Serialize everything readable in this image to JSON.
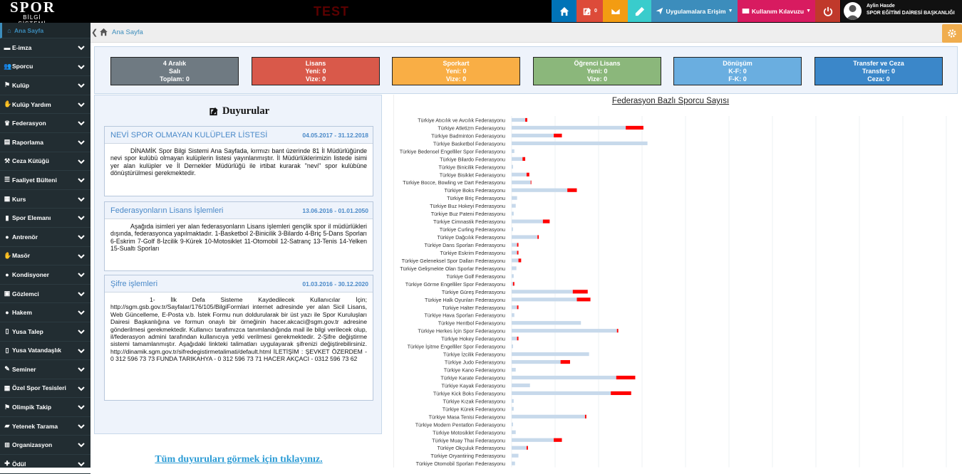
{
  "brand": {
    "logo_big": "SPOR",
    "logo_small": "BİLGİ SİSTEMİ",
    "env_label": "TEST"
  },
  "topbar": {
    "notification_count": "0",
    "app_access_label": "Uygulamalara Erişim",
    "guide_label": "Kullanım Kılavuzu",
    "user_name": "Aylin Hasde",
    "user_dept": "SPOR EĞİTİMİ DAİRESİ BAŞKANLIĞI",
    "colors": {
      "home": "#0073b7",
      "notify": "#dd4b39",
      "mail": "#f39c12",
      "edit": "#39cccc",
      "apps": "#3c8dbc",
      "guide": "#d81b60",
      "power": "#c0392b"
    }
  },
  "sidebar": {
    "items": [
      {
        "label": "Ana Sayfa",
        "icon": "home-icon"
      },
      {
        "label": "E-imza",
        "icon": "card-icon"
      },
      {
        "label": "Sporcu",
        "icon": "users-icon"
      },
      {
        "label": "Kulüp",
        "icon": "flag-icon"
      },
      {
        "label": "Kulüp Yardım",
        "icon": "handshake-icon"
      },
      {
        "label": "Federasyon",
        "icon": "trophy-icon"
      },
      {
        "label": "Raporlama",
        "icon": "report-icon"
      },
      {
        "label": "Ceza Kütüğü",
        "icon": "gavel-icon"
      },
      {
        "label": "Faaliyet Bülteni",
        "icon": "list-icon"
      },
      {
        "label": "Kurs",
        "icon": "building-icon"
      },
      {
        "label": "Spor Elemanı",
        "icon": "book-icon"
      },
      {
        "label": "Antrenör",
        "icon": "user-icon"
      },
      {
        "label": "Masör",
        "icon": "hand-icon"
      },
      {
        "label": "Kondisyoner",
        "icon": "user-icon"
      },
      {
        "label": "Gözlemci",
        "icon": "id-icon"
      },
      {
        "label": "Hakem",
        "icon": "user-icon"
      },
      {
        "label": "Yusa Talep",
        "icon": "doc-icon"
      },
      {
        "label": "Yusa Vatandaşlık",
        "icon": "doc-icon"
      },
      {
        "label": "Seminer",
        "icon": "edit-icon"
      },
      {
        "label": "Özel Spor Tesisleri",
        "icon": "building-icon"
      },
      {
        "label": "Olimpik Takip",
        "icon": "flag-icon"
      },
      {
        "label": "Yetenek Tarama",
        "icon": "car-icon"
      },
      {
        "label": "Organizasyon",
        "icon": "sitemap-icon"
      },
      {
        "label": "Ödül",
        "icon": "gift-icon"
      }
    ]
  },
  "breadcrumb": {
    "home": "Ana Sayfa"
  },
  "stats": [
    {
      "title": "4 Aralık",
      "line1": "Salı",
      "line2": "Toplam: 0",
      "color": "#6f7a82"
    },
    {
      "title": "Lisans",
      "line1": "Yeni: 0",
      "line2": "Vize: 0",
      "color": "#d9594a"
    },
    {
      "title": "Sporkart",
      "line1": "Yeni: 0",
      "line2": "Vize: 0",
      "color": "#f9ae45"
    },
    {
      "title": "Öğrenci Lisans",
      "line1": "Yeni: 0",
      "line2": "Vize: 0",
      "color": "#8bb77b"
    },
    {
      "title": "Dönüşüm",
      "line1": "K-F: 0",
      "line2": "F-K: 0",
      "color": "#6aaee0"
    },
    {
      "title": "Transfer ve Ceza",
      "line1": "Transfer: 0",
      "line2": "Ceza: 0",
      "color": "#3b87c9"
    }
  ],
  "announcements": {
    "title": "Duyurular",
    "link": "Tüm duyuruları görmek için tıklayınız.",
    "items": [
      {
        "title": "NEVİ SPOR OLMAYAN KULÜPLER LİSTESİ",
        "date": "04.05.2017 - 31.12.2018",
        "body": "DİNAMİK Spor Bilgi Sistemi Ana Sayfada, kırmızı bant üzerinde 81 İl Müdürlüğünde nevi spor kulübü olmayan kulüplerin listesi yayınlanmıştır. İl Müdürlüklerimizin listede isimi yer alan kulüpler ve İl Dernekler Müdürlüğü ile irtibat kurarak \"nevi\" spor kulübüne dönüştürülmesi gerekmektedir."
      },
      {
        "title": "Federasyonların Lisans İşlemleri",
        "date": "13.06.2016 - 01.01.2050",
        "body": "Aşağıda isimleri yer alan federasyonların Lisans işlemleri gençlik spor il müdürlükleri dışında, federasyonca yapılmaktadır. 1-Basketbol 2-Binicilik 3-Bilardo 4-Briç 5-Dans Sporları 6-Eskrim 7-Golf 8-İzcilik 9-Kürek 10-Motosiklet 11-Otomobil 12-Satranç 13-Tenis 14-Yelken 15-Sualtı Sporları"
      },
      {
        "title": "Şifre işlemleri",
        "date": "01.03.2016 - 30.12.2020",
        "body": "1- İlk Defa Sisteme Kaydedilecek Kullanıcılar İçin; http://sgm.gsb.gov.tr/Sayfalar/176/105/BilgiFormlari internet adresinde yer alan Sicil Lisans, Web Güncelleme, E-Posta v.b. İstek Formu nun doldurularak bir üst yazı ile Spor Kuruluşları Dairesi Başkanlığına ve formun onaylı bir örneğinin hacer.akcaci@sgm.gov.tr adresine gönderilmesi gerekmektedir. Kullanıcı tarafımızca tanımlandığında mail ile bilgi verilecek olup, il/federasyon admini tarafından kullanıcıya yetki verilmesi gerekmektedir. 2-Şifre değiştirme sistemi tamamlanmıştır. Aşağıdaki linkteki talimatları uygulayarak şifrenizi değiştirebilirsiniz. http://dinamik.sgm.gov.tr/sifredegistirmetalimati/default.html İLETİŞİM : ŞEVKET ÖZERDEM - 0 312 596 73 73 FUNDA TARIKAHYA - 0 312 596 73 71 HACER AKÇACI - 0312 596 73 62"
      }
    ]
  },
  "chart_data": {
    "type": "bar",
    "orientation": "horizontal",
    "stacked": true,
    "title": "Federasyon Bazlı Sporcu Sayısı",
    "categories": [
      "Türkiye Atıcılık ve Avcılık Federasyonu",
      "Türkiye Atletizm Federasyonu",
      "Türkiye Badminton Federasyonu",
      "Türkiye Basketbol Federasyonu",
      "Türkiye Bedensel Engelliler Spor Federasyonu",
      "Türkiye Bilardo Federasyonu",
      "Türkiye Binicilik Federasyonu",
      "Türkiye Bisiklet Federasyonu",
      "Türkiye Bocce, Bowling ve Dart Federasyonu",
      "Türkiye Boks Federasyonu",
      "Türkiye Briç Federasyonu",
      "Türkiye Buz Hokeyi Federasyonu",
      "Türkiye Buz Pateni Federasyonu",
      "Türkiye Cimnastik Federasyonu",
      "Türkiye Curling Federasyonu",
      "Türkiye Dağcılık Federasyonu",
      "Türkiye Dans Sporları Federasyonu",
      "Türkiye Eskrim Federasyonu",
      "Türkiye Geleneksel Spor Dalları Federasyonu",
      "Türkiye Gelişmekte Olan Sporlar Federasyonu",
      "Türkiye Golf Federasyonu",
      "Türkiye Görme Engelliler Spor Federasyonu",
      "Türkiye Güreş Federasyonu",
      "Türkiye Halk Oyunları Federasyonu",
      "Türkiye Halter Federasyonu",
      "Türkiye Hava Sporları Federasyonu",
      "Türkiye Hentbol Federasyonu",
      "Türkiye Herkes İçin Spor Federasyonu",
      "Türkiye Hokey Federasyonu",
      "Türkiye İşitme Engelliler Spor Federasyonu",
      "Türkiye İzcilik Federasyonu",
      "Türkiye Judo Federasyonu",
      "Türkiye Kano Federasyonu",
      "Türkiye Karate Federasyonu",
      "Türkiye Kayak Federasyonu",
      "Türkiye Kick Boks Federasyonu",
      "Türkiye Kızak Federasyonu",
      "Türkiye Kürek Federasyonu",
      "Türkiye Masa Tenisi Federasyonu",
      "Türkiye Modern Pentatlon Federasyonu",
      "Türkiye Motosiklet Federasyonu",
      "Türkiye Muay Thai Federasyonu",
      "Türkiye Okçuluk Federasyonu",
      "Türkiye Oryantiring Federasyonu",
      "Türkiye Otomobil Sporları Federasyonu"
    ],
    "series": [
      {
        "values": [
          20,
          168,
          62,
          200,
          4,
          16,
          2,
          22,
          28,
          82,
          8,
          6,
          3,
          46,
          2,
          38,
          8,
          8,
          10,
          7,
          3,
          2,
          90,
          96,
          8,
          4,
          102,
          155,
          8,
          2,
          114,
          72,
          6,
          154,
          27,
          146,
          3,
          3,
          108,
          2,
          6,
          62,
          22,
          10,
          5
        ],
        "color": "#c7d9eb"
      },
      {
        "values": [
          3,
          26,
          12,
          0,
          0,
          4,
          0,
          4,
          1,
          14,
          0,
          0,
          0,
          10,
          0,
          2,
          2,
          2,
          4,
          0,
          0,
          2,
          22,
          20,
          2,
          0,
          0,
          2,
          2,
          0,
          0,
          14,
          0,
          28,
          0,
          30,
          0,
          0,
          2,
          0,
          0,
          12,
          2,
          0,
          0
        ],
        "color": "#ff0000"
      }
    ],
    "gridlines": true,
    "legend": "none"
  }
}
